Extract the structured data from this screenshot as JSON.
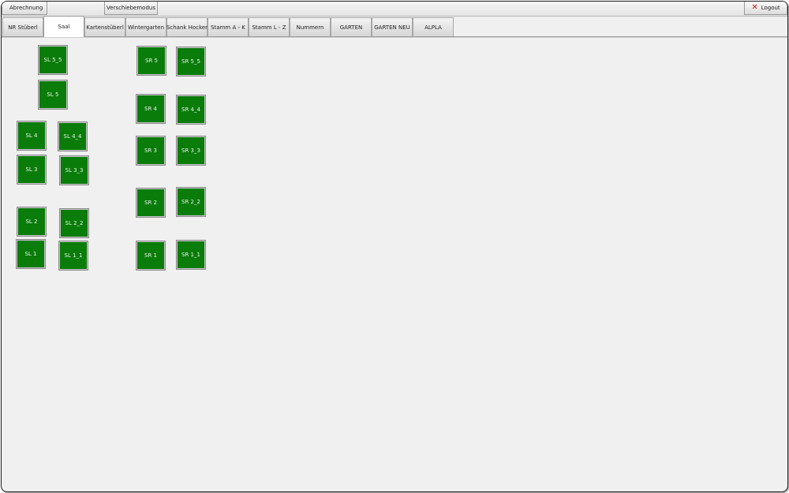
{
  "toolbar": {
    "abrechnung_label": "Abrechnung",
    "verschiebemodus_label": "Verschiebemodus",
    "logout_label": "Logout",
    "logout_icon": "close-x-icon",
    "logout_icon_color": "#cc1111"
  },
  "tabs": [
    {
      "label": "NR Stüberl",
      "active": false
    },
    {
      "label": "Saal",
      "active": true
    },
    {
      "label": "Kartenstüberl",
      "active": false
    },
    {
      "label": "Wintergarten",
      "active": false
    },
    {
      "label": "Schank Hocker",
      "active": false
    },
    {
      "label": "Stamm A - K",
      "active": false
    },
    {
      "label": "Stamm L - Z",
      "active": false
    },
    {
      "label": "Nummern",
      "active": false
    },
    {
      "label": "GARTEN",
      "active": false
    },
    {
      "label": "GARTEN NEU",
      "active": false
    },
    {
      "label": "ALPLA",
      "active": false
    }
  ],
  "tables": [
    {
      "label": "SL 5_5",
      "status_color": "#0a7c0a"
    },
    {
      "label": "SL 5",
      "status_color": "#0a7c0a"
    },
    {
      "label": "SL 4",
      "status_color": "#0a7c0a"
    },
    {
      "label": "SL 4_4",
      "status_color": "#0a7c0a"
    },
    {
      "label": "SL 3",
      "status_color": "#0a7c0a"
    },
    {
      "label": "SL 3_3",
      "status_color": "#0a7c0a"
    },
    {
      "label": "SL 2",
      "status_color": "#0a7c0a"
    },
    {
      "label": "SL 2_2",
      "status_color": "#0a7c0a"
    },
    {
      "label": "SL 1",
      "status_color": "#0a7c0a"
    },
    {
      "label": "SL 1_1",
      "status_color": "#0a7c0a"
    },
    {
      "label": "SR 5",
      "status_color": "#0a7c0a"
    },
    {
      "label": "SR 5_5",
      "status_color": "#0a7c0a"
    },
    {
      "label": "SR 4",
      "status_color": "#0a7c0a"
    },
    {
      "label": "SR 4_4",
      "status_color": "#0a7c0a"
    },
    {
      "label": "SR 3",
      "status_color": "#0a7c0a"
    },
    {
      "label": "SR 3_3",
      "status_color": "#0a7c0a"
    },
    {
      "label": "SR 2",
      "status_color": "#0a7c0a"
    },
    {
      "label": "SR 2_2",
      "status_color": "#0a7c0a"
    },
    {
      "label": "SR 1",
      "status_color": "#0a7c0a"
    },
    {
      "label": "SR 1_1",
      "status_color": "#0a7c0a"
    }
  ]
}
